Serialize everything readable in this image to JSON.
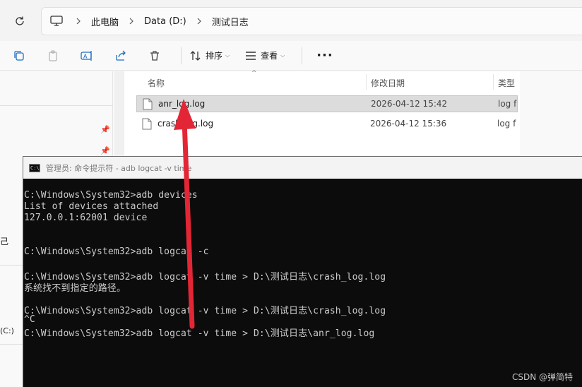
{
  "breadcrumb": {
    "items": [
      "此电脑",
      "Data (D:)",
      "测试日志"
    ]
  },
  "toolbar": {
    "sort_label": "排序",
    "view_label": "查看",
    "more_label": "···"
  },
  "navpane": {
    "stub_text_1": "己",
    "stub_text_2": "(C:)"
  },
  "filelist": {
    "columns": [
      "名称",
      "修改日期",
      "类型"
    ],
    "rows": [
      {
        "name": "anr_log.log",
        "date": "2026-04-12 15:42",
        "type": "log f"
      },
      {
        "name": "crash_log.log",
        "date": "2026-04-12 15:36",
        "type": "log f"
      }
    ]
  },
  "console": {
    "title": "管理员: 命令提示符 - adb  logcat -v time",
    "lines": [
      "C:\\Windows\\System32>adb devices",
      "List of devices attached",
      "127.0.0.1:62001 device",
      "",
      "",
      "C:\\Windows\\System32>adb logcat -c",
      "",
      "C:\\Windows\\System32>adb logcat -v time > D:\\测试日志\\crash_log.log",
      "系统找不到指定的路径。",
      "",
      "C:\\Windows\\System32>adb logcat -v time > D:\\测试日志\\crash_log.log",
      "^C",
      "C:\\Windows\\System32>adb logcat -v time > D:\\测试日志\\anr_log.log"
    ],
    "watermark": "CSDN @弹简特"
  },
  "colors": {
    "annotation_arrow": "#e32636",
    "console_bg": "#0c0c0c",
    "console_text": "#cccccc"
  }
}
